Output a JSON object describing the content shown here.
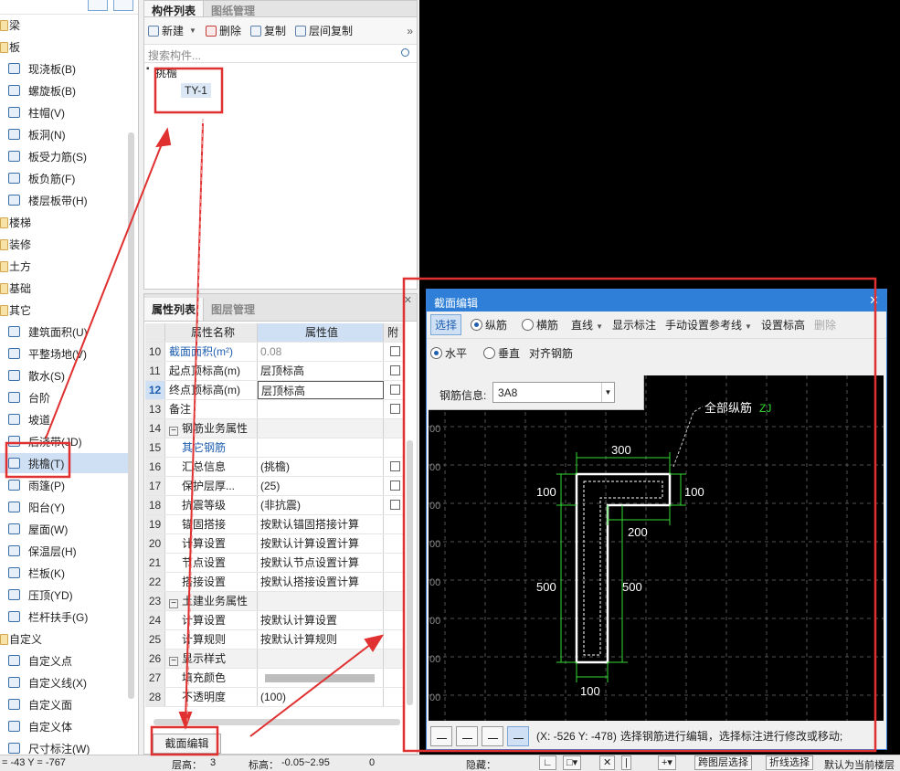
{
  "left_tree": {
    "items": [
      {
        "label": "梁",
        "kind": "cat"
      },
      {
        "label": "板",
        "kind": "cat"
      },
      {
        "label": "现浇板(B)",
        "kind": "item"
      },
      {
        "label": "螺旋板(B)",
        "kind": "item"
      },
      {
        "label": "柱帽(V)",
        "kind": "item"
      },
      {
        "label": "板洞(N)",
        "kind": "item"
      },
      {
        "label": "板受力筋(S)",
        "kind": "item"
      },
      {
        "label": "板负筋(F)",
        "kind": "item"
      },
      {
        "label": "楼层板带(H)",
        "kind": "item"
      },
      {
        "label": "楼梯",
        "kind": "cat"
      },
      {
        "label": "装修",
        "kind": "cat"
      },
      {
        "label": "土方",
        "kind": "cat"
      },
      {
        "label": "基础",
        "kind": "cat"
      },
      {
        "label": "其它",
        "kind": "cat"
      },
      {
        "label": "建筑面积(U)",
        "kind": "item"
      },
      {
        "label": "平整场地(V)",
        "kind": "item"
      },
      {
        "label": "散水(S)",
        "kind": "item"
      },
      {
        "label": "台阶",
        "kind": "item"
      },
      {
        "label": "坡道",
        "kind": "item"
      },
      {
        "label": "后浇带(JD)",
        "kind": "item"
      },
      {
        "label": "挑檐(T)",
        "kind": "item",
        "selected": true
      },
      {
        "label": "雨篷(P)",
        "kind": "item"
      },
      {
        "label": "阳台(Y)",
        "kind": "item"
      },
      {
        "label": "屋面(W)",
        "kind": "item"
      },
      {
        "label": "保温层(H)",
        "kind": "item"
      },
      {
        "label": "栏板(K)",
        "kind": "item"
      },
      {
        "label": "压顶(YD)",
        "kind": "item"
      },
      {
        "label": "栏杆扶手(G)",
        "kind": "item"
      },
      {
        "label": "自定义",
        "kind": "cat"
      },
      {
        "label": "自定义点",
        "kind": "item"
      },
      {
        "label": "自定义线(X)",
        "kind": "item"
      },
      {
        "label": "自定义面",
        "kind": "item"
      },
      {
        "label": "自定义体",
        "kind": "item"
      },
      {
        "label": "尺寸标注(W)",
        "kind": "item"
      }
    ]
  },
  "component_panel": {
    "tabs": [
      "构件列表",
      "图纸管理"
    ],
    "toolbar": {
      "new": "新建",
      "delete": "删除",
      "copy": "复制",
      "floor_copy": "层间复制"
    },
    "search_placeholder": "搜索构件...",
    "root": "挑檐",
    "child": "TY-1"
  },
  "property_panel": {
    "tabs": [
      "属性列表",
      "图层管理"
    ],
    "header": {
      "name": "属性名称",
      "value": "属性值",
      "extra": "附"
    },
    "rows": [
      {
        "num": "10",
        "name": "截面面积(m²)",
        "value": "0.08",
        "name_style": "blue",
        "value_style": "gray",
        "check": true
      },
      {
        "num": "11",
        "name": "起点顶标高(m)",
        "value": "层顶标高",
        "check": true
      },
      {
        "num": "12",
        "name": "终点顶标高(m)",
        "value": "层顶标高",
        "check": true,
        "active": true
      },
      {
        "num": "13",
        "name": "备注",
        "value": "",
        "check": true
      },
      {
        "num": "14",
        "name": "钢筋业务属性",
        "value": "",
        "group": true
      },
      {
        "num": "15",
        "name": "其它钢筋",
        "value": "",
        "name_style": "blue",
        "indent": true
      },
      {
        "num": "16",
        "name": "汇总信息",
        "value": "(挑檐)",
        "indent": true,
        "check": true
      },
      {
        "num": "17",
        "name": "保护层厚...",
        "value": "(25)",
        "indent": true,
        "check": true
      },
      {
        "num": "18",
        "name": "抗震等级",
        "value": "(非抗震)",
        "indent": true,
        "check": true
      },
      {
        "num": "19",
        "name": "锚固搭接",
        "value": "按默认锚固搭接计算",
        "indent": true
      },
      {
        "num": "20",
        "name": "计算设置",
        "value": "按默认计算设置计算",
        "indent": true
      },
      {
        "num": "21",
        "name": "节点设置",
        "value": "按默认节点设置计算",
        "indent": true
      },
      {
        "num": "22",
        "name": "搭接设置",
        "value": "按默认搭接设置计算",
        "indent": true
      },
      {
        "num": "23",
        "name": "土建业务属性",
        "value": "",
        "group": true
      },
      {
        "num": "24",
        "name": "计算设置",
        "value": "按默认计算设置",
        "indent": true
      },
      {
        "num": "25",
        "name": "计算规则",
        "value": "按默认计算规则",
        "indent": true
      },
      {
        "num": "26",
        "name": "显示样式",
        "value": "",
        "group": true
      },
      {
        "num": "27",
        "name": "填充颜色",
        "value": "",
        "indent": true,
        "fill": true
      },
      {
        "num": "28",
        "name": "不透明度",
        "value": "(100)",
        "indent": true
      }
    ],
    "section_edit_button": "截面编辑"
  },
  "dialog": {
    "title": "截面编辑",
    "toolbar1": {
      "select": "选择",
      "longitudinal": "纵筋",
      "transverse": "横筋",
      "line": "直线",
      "show_dim": "显示标注",
      "manual_ref": "手动设置参考线",
      "set_elev": "设置标高",
      "delete": "删除"
    },
    "toolbar2": {
      "horizontal": "水平",
      "vertical": "垂直",
      "align": "对齐钢筋"
    },
    "rebar_info_label": "钢筋信息:",
    "rebar_info_value": "3A8",
    "drawing": {
      "callout": "全部纵筋",
      "callout_code": "ZJ",
      "dims": {
        "top": "300",
        "left_top": "100",
        "right_top": "100",
        "inner": "200",
        "left_mid": "500",
        "right_mid": "500",
        "bottom": "100"
      },
      "grid_edge_labels": [
        "00",
        "00",
        "00",
        "00",
        "00",
        "00",
        "00",
        "00"
      ]
    },
    "status_coords": "(X: -526 Y: -478)",
    "status_text": "选择钢筋进行编辑，选择标注进行修改或移动;"
  },
  "status_bar": {
    "coords": "= -43 Y = -767",
    "floor_label": "层高：",
    "floor_value": "3",
    "elev_label": "标高：",
    "elev_value": "-0.05~2.95",
    "zero": "0",
    "hidden_label": "隐藏：",
    "cross_floor": "跨图层选择",
    "polyline_select": "折线选择",
    "default_floor": "默认为当前楼层"
  },
  "colors": {
    "accent": "#2f7fd8",
    "annotation_red": "#e03030",
    "dim_green": "#33dd33",
    "selection": "#cfe0f5"
  }
}
